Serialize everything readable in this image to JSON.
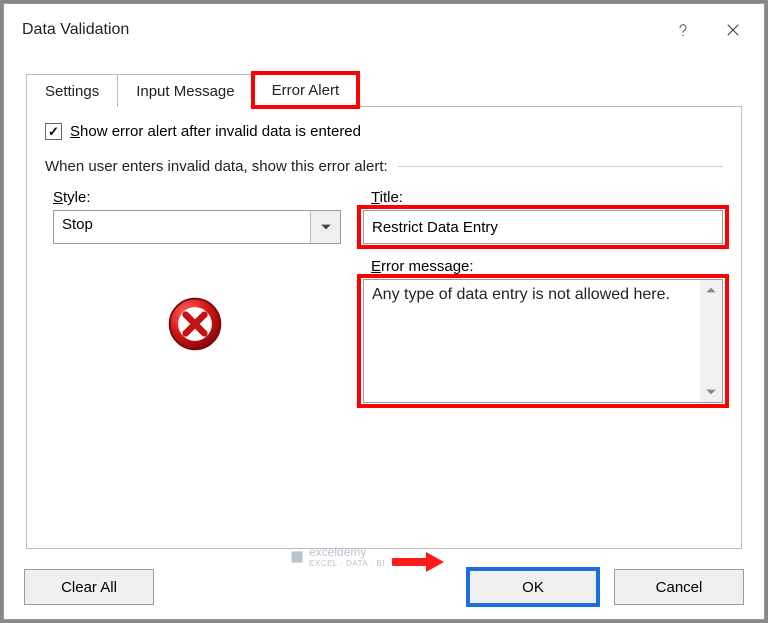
{
  "titlebar": {
    "title": "Data Validation"
  },
  "tabs": {
    "settings": "Settings",
    "input_message": "Input Message",
    "error_alert": "Error Alert"
  },
  "checkbox": {
    "checked": true,
    "label": "Show error alert after invalid data is entered"
  },
  "group_caption": "When user enters invalid data, show this error alert:",
  "style": {
    "label": "Style:",
    "value": "Stop"
  },
  "title_field": {
    "label": "Title:",
    "value": "Restrict Data Entry"
  },
  "error_message": {
    "label": "Error message:",
    "value": "Any type of data entry is not allowed here."
  },
  "buttons": {
    "clear_all": "Clear All",
    "ok": "OK",
    "cancel": "Cancel"
  },
  "watermark": {
    "brand": "exceldemy",
    "sub": "EXCEL · DATA · BI"
  }
}
